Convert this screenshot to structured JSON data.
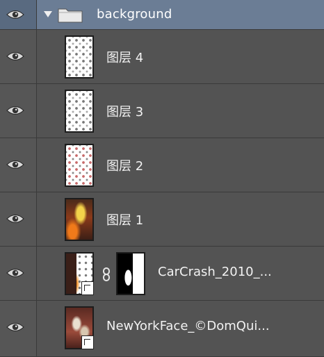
{
  "group": {
    "name": "background",
    "expanded": true,
    "visible": true,
    "icon": "folder-icon"
  },
  "layers": [
    {
      "name": "图层 4",
      "thumbnail": "pattern",
      "visible": true
    },
    {
      "name": "图层 3",
      "thumbnail": "pattern",
      "visible": true
    },
    {
      "name": "图层 2",
      "thumbnail": "pattern-red",
      "visible": true
    },
    {
      "name": "图层 1",
      "thumbnail": "photo-fire",
      "visible": true
    },
    {
      "name": "CarCrash_2010_...",
      "thumbnail": "smart-object",
      "has_mask": true,
      "linked": true,
      "visible": true
    },
    {
      "name": "NewYorkFace_©DomQui...",
      "thumbnail": "smart-object",
      "visible": true
    }
  ],
  "colors": {
    "panel_bg": "#535353",
    "selected_group": "#6b7d95",
    "row_border": "#3a3a3a"
  }
}
